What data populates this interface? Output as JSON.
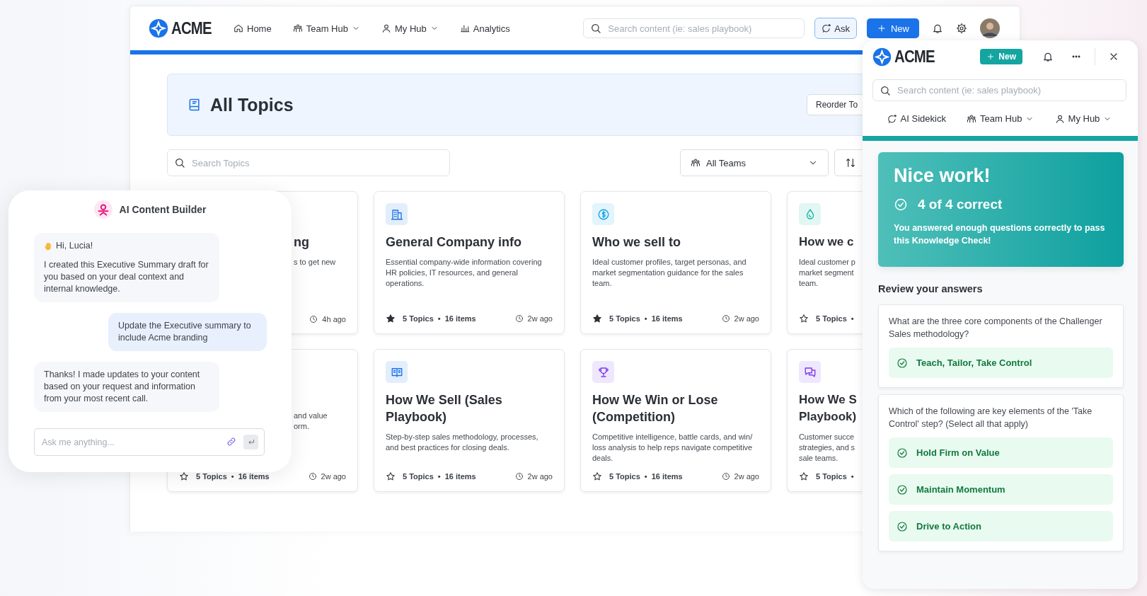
{
  "main_window": {
    "nav": {
      "logo": "ACME",
      "items": [
        {
          "label": "Home",
          "dropdown": false
        },
        {
          "label": "Team Hub",
          "dropdown": true
        },
        {
          "label": "My Hub",
          "dropdown": true
        },
        {
          "label": "Analytics",
          "dropdown": false
        }
      ],
      "search": {
        "placeholder": "Search content (ie: sales playbook)"
      },
      "ask_button": "Ask",
      "new_button": "New"
    },
    "header": {
      "title": "All Topics",
      "reorder_button": "Reorder To"
    },
    "filters": {
      "search": {
        "placeholder": "Search Topics"
      },
      "team_select": "All Teams"
    },
    "cards": {
      "separator": "•",
      "items": [
        {
          "kind": "covered",
          "title": "ng",
          "description": "s to get new",
          "time": "4h ago"
        },
        {
          "kind": "full",
          "color": "#1a73e8",
          "title": "General Company info",
          "description": "Essential company-wide information covering HR policies, IT resources, and general operations.",
          "starred": true,
          "topics": "5 Topics",
          "items": "16 items",
          "time": "2w ago"
        },
        {
          "kind": "full",
          "color": "#0ea5e9",
          "title": "Who we sell to",
          "description": "Ideal customer profiles, target personas, and market segmentation guidance for the sales team.",
          "starred": true,
          "topics": "5 Topics",
          "items": "16 items",
          "time": "2w ago"
        },
        {
          "kind": "clipped",
          "color": "#14b8a6",
          "title": "How we c",
          "description": "Ideal customer p\nmarket segment\nteam.",
          "starred": false,
          "topics": "5 Topics"
        },
        {
          "kind": "covered",
          "description": "and value\norm.",
          "starred": false,
          "topics": "5 Topics",
          "items": "16 items",
          "time": "2w ago"
        },
        {
          "kind": "full",
          "color": "#1a73e8",
          "title": "How We Sell (Sales Playbook)",
          "description": "Step-by-step sales methodology, processes, and best practices for closing deals.",
          "starred": false,
          "topics": "5 Topics",
          "items": "16 items",
          "time": "2w ago"
        },
        {
          "kind": "full",
          "color": "#7c3aed",
          "title": "How We Win or Lose (Competition)",
          "description": "Competitive intelligence, battle cards, and win/ loss analysis to help reps navigate competitive deals.",
          "starred": false,
          "topics": "5 Topics",
          "items": "16 items",
          "time": "2w ago"
        },
        {
          "kind": "clipped",
          "color": "#7c3aed",
          "title": "How We S\nPlaybook)",
          "description": "Customer succe\nstrategies, and s\nsale teams.",
          "starred": false,
          "topics": "5 Topics"
        }
      ]
    }
  },
  "chat_panel": {
    "title": "AI Content Builder",
    "messages": [
      {
        "kind": "assistant",
        "greeting": "Hi, Lucia!",
        "text": "I created this Executive Summary draft for you based on your deal context and internal knowledge."
      },
      {
        "kind": "user",
        "text": "Update the Executive summary to include Acme branding"
      },
      {
        "kind": "assistant",
        "text": "Thanks! I made updates to your content based on your request and information from your most recent call."
      }
    ],
    "input": {
      "placeholder": "Ask me anything..."
    }
  },
  "side_panel": {
    "logo": "ACME",
    "new_button": "New",
    "search": {
      "placeholder": "Search content (ie: sales playbook)"
    },
    "nav": [
      {
        "label": "AI Sidekick",
        "dropdown": false
      },
      {
        "label": "Team Hub",
        "dropdown": true
      },
      {
        "label": "My Hub",
        "dropdown": true
      }
    ],
    "result": {
      "title": "Nice work!",
      "score": "4 of 4 correct",
      "message": "You answered enough questions correctly to pass this Knowledge Check!"
    },
    "review_heading": "Review your answers",
    "questions": [
      {
        "question": "What are the three core components of the Challenger Sales methodology?",
        "answers": [
          {
            "text": "Teach, Tailor, Take Control",
            "correct": true
          }
        ]
      },
      {
        "question": "Which of the following are key elements of the 'Take Control' step? (Select all that apply)",
        "answers": [
          {
            "text": "Hold Firm on Value",
            "correct": true
          },
          {
            "text": "Maintain Momentum",
            "correct": true
          },
          {
            "text": "Drive to Action",
            "correct": true
          }
        ]
      }
    ]
  }
}
